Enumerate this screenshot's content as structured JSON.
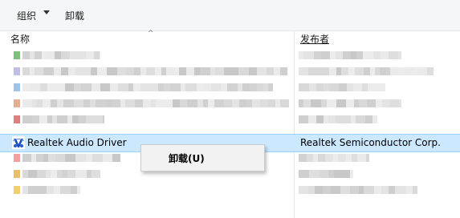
{
  "toolbar": {
    "organize_label": "组织",
    "uninstall_label": "卸载"
  },
  "columns": {
    "name_header": "名称",
    "publisher_header": "发布者"
  },
  "selected_program": {
    "name": "Realtek Audio Driver",
    "publisher": "Realtek Semiconductor Corp."
  },
  "context_menu": {
    "items": [
      {
        "label": "卸载(U)"
      }
    ]
  },
  "colors": {
    "selection_background": "#cce8ff",
    "selection_border": "#99d1ff",
    "toolbar_background": "#f5f6f7",
    "context_menu_background": "#f2f2f2"
  },
  "icons": {
    "selected_program_icon": "realtek-audio-icon",
    "organize_dropdown": "chevron-down-icon"
  }
}
